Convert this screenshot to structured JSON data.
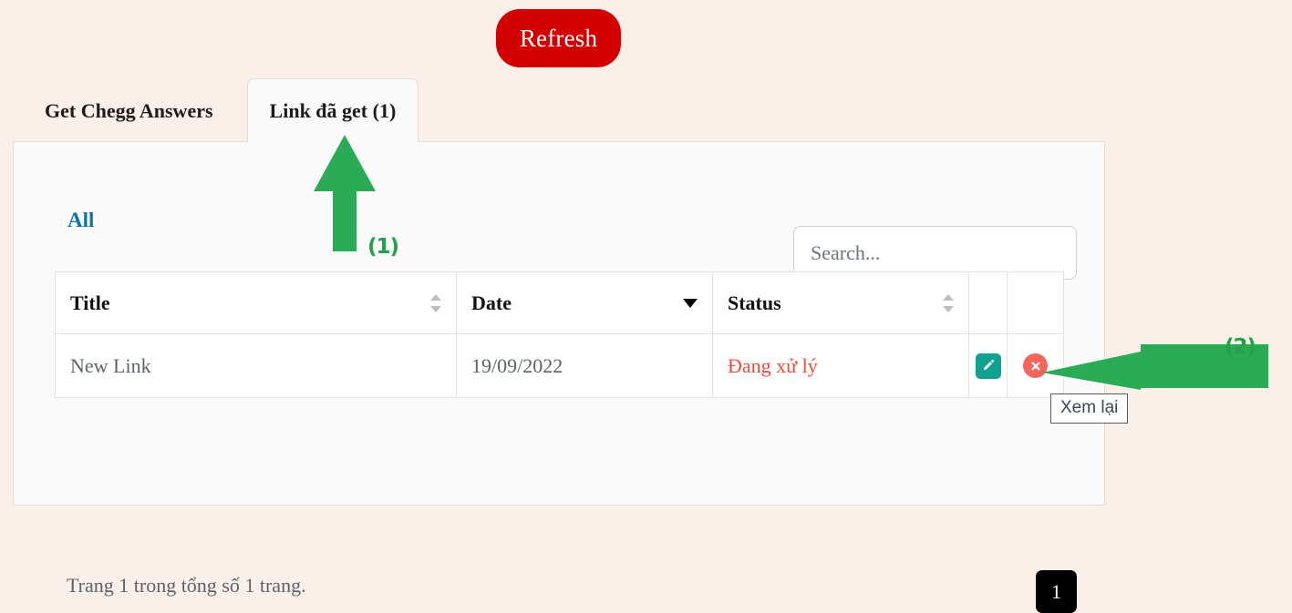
{
  "toolbar": {
    "refresh_label": "Refresh"
  },
  "tabs": [
    {
      "label": "Get Chegg Answers",
      "active": false
    },
    {
      "label": "Link đã get (1)",
      "active": true
    }
  ],
  "filters": {
    "all_label": "All"
  },
  "search": {
    "placeholder": "Search...",
    "value": ""
  },
  "table": {
    "columns": [
      {
        "label": "Title",
        "sort": "both"
      },
      {
        "label": "Date",
        "sort": "desc"
      },
      {
        "label": "Status",
        "sort": "both"
      },
      {
        "label": "",
        "sort": "none"
      },
      {
        "label": "",
        "sort": "none"
      }
    ],
    "rows": [
      {
        "title": "New Link",
        "date": "19/09/2022",
        "status": "Đang xử lý",
        "edit_icon": "pencil-icon",
        "delete_icon": "circle-x-icon"
      }
    ]
  },
  "tooltip": {
    "text": "Xem lại"
  },
  "pagination": {
    "info": "Trang 1 trong tổng số 1 trang.",
    "current_page": "1"
  },
  "annotations": [
    {
      "id": "1",
      "label": "(1)",
      "direction": "up",
      "icon": "arrow-up-icon"
    },
    {
      "id": "2",
      "label": "(2)",
      "direction": "left",
      "icon": "arrow-left-icon"
    }
  ],
  "colors": {
    "page_background": "#fbefe9",
    "card_background": "#fafafa",
    "refresh_red": "#d20000",
    "link_blue": "#0f74a8",
    "status_red": "#ee4b3c",
    "edit_teal": "#12a191",
    "delete_salmon": "#f4665d",
    "annotation_green": "#27a04b"
  }
}
